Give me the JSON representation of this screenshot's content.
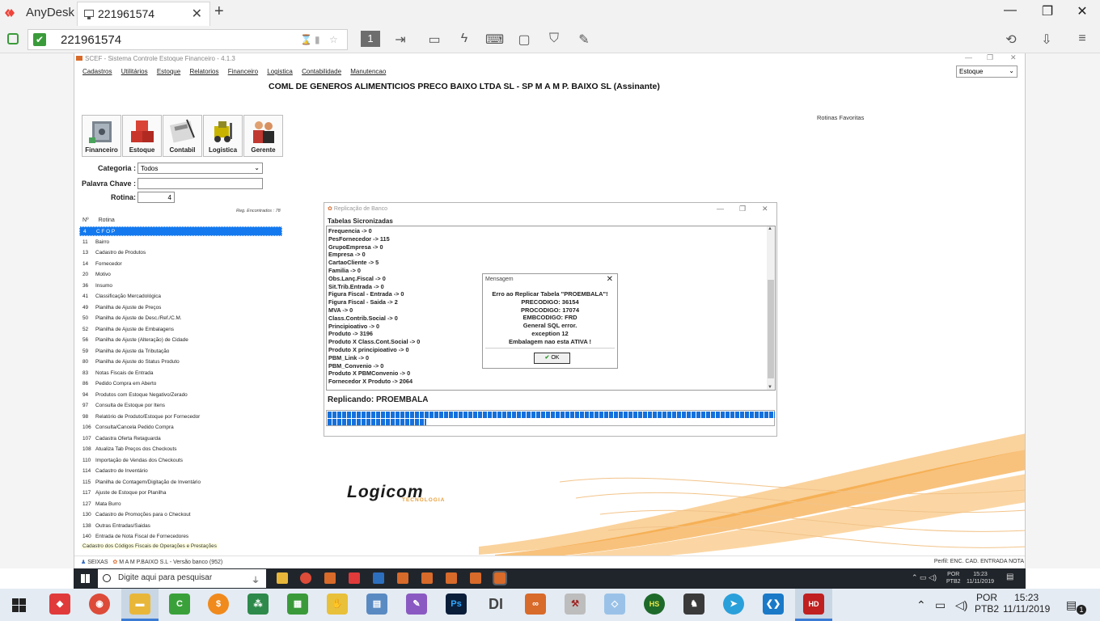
{
  "anydesk": {
    "app_name": "AnyDesk",
    "tab_label": "221961574",
    "address": "221961574",
    "toolbar_display_number": "1"
  },
  "app": {
    "title": "SCEF - Sistema Controle Estoque Financeiro - 4.1.3",
    "menu": [
      "Cadastros",
      "Utilitários",
      "Estoque",
      "Relatorios",
      "Financeiro",
      "Logistica",
      "Contabilidade",
      "Manutencao"
    ],
    "right_select": "Estoque",
    "company": "COML DE GENEROS ALIMENTICIOS PRECO BAIXO LTDA SL - SP M A M P. BAIXO SL (Assinante)",
    "favorites_label": "Rotinas Favoritas",
    "modules": [
      "Financeiro",
      "Estoque",
      "Contabil",
      "Logistica",
      "Gerente"
    ],
    "filters": {
      "categoria_label": "Categoria :",
      "categoria_value": "Todos",
      "palavra_label": "Palavra Chave :",
      "palavra_value": "",
      "rotina_label": "Rotina:",
      "rotina_value": "4"
    },
    "records_found": "Reg. Encontrados : 78",
    "list_headers": [
      "Nº",
      "Rotina"
    ],
    "routines": [
      {
        "n": "4",
        "name": "C F O P"
      },
      {
        "n": "11",
        "name": "Bairro"
      },
      {
        "n": "13",
        "name": "Cadastro de Produtos"
      },
      {
        "n": "14",
        "name": "Fornecedor"
      },
      {
        "n": "20",
        "name": "Motivo"
      },
      {
        "n": "36",
        "name": "Insumo"
      },
      {
        "n": "41",
        "name": "Classificação Mercadológica"
      },
      {
        "n": "49",
        "name": "Planilha de Ajuste de Preços"
      },
      {
        "n": "50",
        "name": "Planilha de Ajuste de Desc./Ref./C.M."
      },
      {
        "n": "52",
        "name": "Planilha de Ajuste de Embalagens"
      },
      {
        "n": "56",
        "name": "Planilha de Ajuste (Alteração) de Cidade"
      },
      {
        "n": "59",
        "name": "Planilha de Ajuste da Tributação"
      },
      {
        "n": "80",
        "name": "Planilha de Ajuste do Status Produto"
      },
      {
        "n": "83",
        "name": "Notas Fiscais de Entrada"
      },
      {
        "n": "86",
        "name": "Pedido Compra em Aberto"
      },
      {
        "n": "94",
        "name": "Produtos com Estoque Negativo/Zerado"
      },
      {
        "n": "97",
        "name": "Consulta de Estoque por Itens"
      },
      {
        "n": "98",
        "name": "Relatório de Produto/Estoque por Fornecedor"
      },
      {
        "n": "106",
        "name": "Consulta/Cancela Pedido Compra"
      },
      {
        "n": "107",
        "name": "Cadastra Oferta Retaguarda"
      },
      {
        "n": "108",
        "name": "Atualiza Tab Preços dos Checkouts"
      },
      {
        "n": "110",
        "name": "Importação de Vendas dos Checkouts"
      },
      {
        "n": "114",
        "name": "Cadastro de Inventário"
      },
      {
        "n": "115",
        "name": "Planilha de Contagem/Digitação de Inventário"
      },
      {
        "n": "117",
        "name": "Ajuste de Estoque por Planilha"
      },
      {
        "n": "127",
        "name": "Mata Burro"
      },
      {
        "n": "130",
        "name": "Cadastro de Promoções para o Checkout"
      },
      {
        "n": "138",
        "name": "Outras Entradas/Saidas"
      },
      {
        "n": "140",
        "name": "Entrada de Nota Fiscal de Fornecedores"
      }
    ],
    "status_line": "Cadastro dos Códigos Fiscais de Operações e Prestações",
    "statusbar_left": "SEIXAS",
    "statusbar_version": "M A M P.BAIXO S.L - Versão banco (952)",
    "statusbar_right": "Perfil: ENC. CAD. ENTRADA NOTA"
  },
  "replication_dialog": {
    "title": "Replicação de Banco",
    "section": "Tabelas Sicronizadas",
    "lines": [
      "Frequencia -> 0",
      "PesFornecedor -> 115",
      "GrupoEmpresa -> 0",
      "Empresa -> 0",
      "CartaoCliente -> 5",
      "Familia -> 0",
      "Obs.Lanç.Fiscal -> 0",
      "Sit.Trib.Entrada -> 0",
      "Figura Fiscal - Entrada -> 0",
      "Figura Fiscal - Saida -> 2",
      "MVA -> 0",
      "Class.Contrib.Social -> 0",
      "Principioativo -> 0",
      "Produto -> 3196",
      "Produto X Class.Cont.Social -> 0",
      "Produto X principioativo -> 0",
      "PBM_Link -> 0",
      "PBM_Convenio -> 0",
      "Produto X PBMConvenio -> 0",
      "Fornecedor X Produto -> 2064"
    ],
    "replicating": "Replicando: PROEMBALA"
  },
  "message_box": {
    "title": "Mensagem",
    "lines": [
      "Erro ao Replicar Tabela \"PROEMBALA\"!",
      "PRECODIGO: 36154",
      "PROCODIGO: 17074",
      "EMBCODIGO: FRD",
      "General SQL error.",
      "exception 12",
      "Embalagem nao esta ATIVA !"
    ],
    "ok_label": "OK"
  },
  "logo": {
    "name": "Logicom",
    "sub": "TECNOLOGIA"
  },
  "remote_taskbar": {
    "search_placeholder": "Digite aqui para pesquisar",
    "lang": "POR",
    "layout": "PTB2",
    "time": "15:23",
    "date": "11/11/2019"
  },
  "local_taskbar": {
    "lang": "POR",
    "layout": "PTB2",
    "time": "15:23",
    "date": "11/11/2019",
    "notifications": "1"
  }
}
